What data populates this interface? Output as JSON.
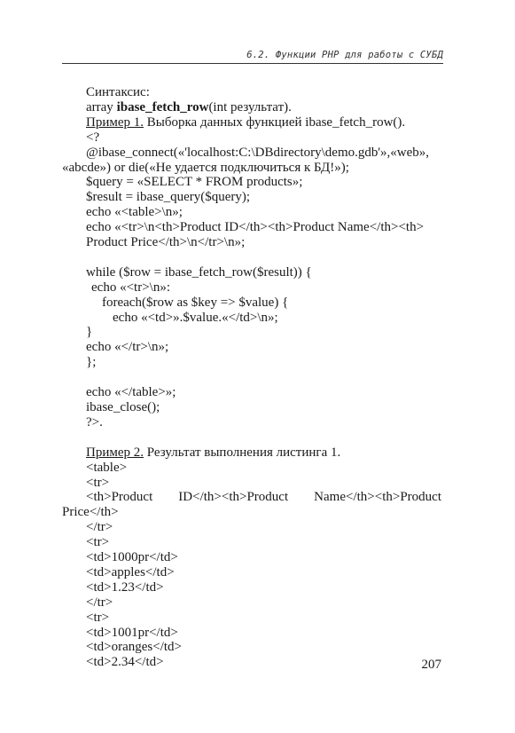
{
  "header": {
    "running_title": "6.2. Функции PHP для работы с СУБД"
  },
  "section": {
    "syntax_label": "Синтаксис:",
    "syntax_prefix": "array ",
    "syntax_function": "ibase_fetch_row",
    "syntax_suffix": "(int результат).",
    "example1_label": "Пример 1.",
    "example1_caption": " Выборка данных функцией ibase_fetch_row()."
  },
  "code1": [
    "<?",
    "@ibase_connect(«'localhost:C:\\DBdirectory\\demo.gdb'»,«web»,",
    "«abcde») or die(«Не удается подключиться к БД!»);",
    "$query = «SELECT * FROM products»;",
    "$result = ibase_query($query);",
    "echo «<table>\\n»;",
    "echo «<tr>\\n<th>Product ID</th><th>Product Name</th><th>",
    "Product Price</th>\\n</tr>\\n»;",
    "while ($row = ibase_fetch_row($result)) {",
    "echo «<tr>\\n»:",
    "foreach($row as $key => $value) {",
    "echo «<td>».$value.«</td>\\n»;",
    "}",
    "echo «</tr>\\n»;",
    "};",
    "echo «</table>»;",
    "ibase_close();",
    "?>."
  ],
  "example2": {
    "label": "Пример 2.",
    "caption": " Результат выполнения листинга 1."
  },
  "code2": [
    "<table>",
    "<tr>",
    "<th>Product ID</th><th>Product Name</th><th>Product",
    "Price</th>",
    "</tr>",
    "<tr>",
    "<td>1000pr</td>",
    "<td>apples</td>",
    "<td>1.23</td>",
    "</tr>",
    "<tr>",
    "<td>1001pr</td>",
    "<td>oranges</td>",
    "<td>2.34</td>"
  ],
  "footer": {
    "page_number": "207"
  }
}
